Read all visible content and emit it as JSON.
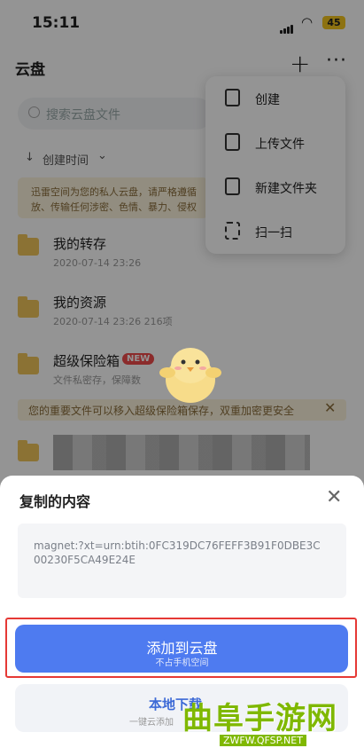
{
  "status": {
    "time": "15:11",
    "battery": "45"
  },
  "header": {
    "title": "云盘"
  },
  "search": {
    "placeholder": "搜索云盘文件"
  },
  "sort": {
    "label": "创建时间"
  },
  "notice": {
    "text": "迅雷空间为您的私人云盘，请严格遵循\n放、传输任何涉密、色情、暴力、侵权"
  },
  "folders": [
    {
      "name": "我的转存",
      "meta": "2020-07-14 23:26"
    },
    {
      "name": "我的资源",
      "meta": "2020-07-14 23:26  216项"
    },
    {
      "name": "超级保险箱",
      "meta": "文件私密存，保障数",
      "badge": "NEW"
    }
  ],
  "vault_notice": {
    "text": "您的重要文件可以移入超级保险箱保存，双重加密更安全"
  },
  "menu": {
    "items": [
      {
        "label": "创建",
        "icon": "create-icon"
      },
      {
        "label": "上传文件",
        "icon": "upload-file-icon"
      },
      {
        "label": "新建文件夹",
        "icon": "new-folder-icon"
      },
      {
        "label": "扫一扫",
        "icon": "scan-icon"
      }
    ]
  },
  "sheet": {
    "title": "复制的内容",
    "content": "magnet:?xt=urn:btih:0FC319DC76FEFF3B91F0DBE3C00230F5CA49E24E",
    "primary": {
      "label": "添加到云盘",
      "sub": "不占手机空间"
    },
    "secondary": {
      "label": "本地下载",
      "sub": "一键云添加"
    }
  },
  "watermark": {
    "text": "曲阜手游网",
    "url": "ZWFW.QFSP.NET"
  },
  "colors": {
    "primary": "#4e7bf0",
    "highlight": "#e53935",
    "folder": "#efc45a"
  }
}
